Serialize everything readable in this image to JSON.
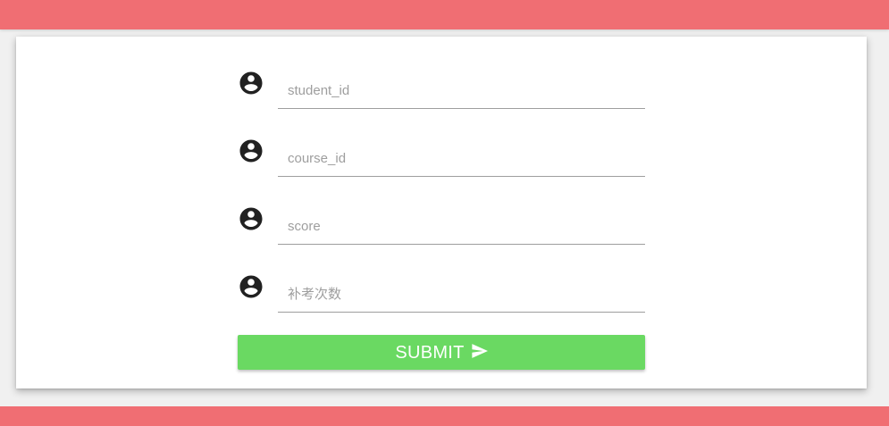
{
  "colors": {
    "bar": "#f06e73",
    "submit_bg": "#6ad962",
    "icon": "#212121"
  },
  "form": {
    "fields": [
      {
        "placeholder": "student_id",
        "value": "",
        "icon": "account-circle-icon"
      },
      {
        "placeholder": "course_id",
        "value": "",
        "icon": "account-circle-icon"
      },
      {
        "placeholder": "score",
        "value": "",
        "icon": "account-circle-icon"
      },
      {
        "placeholder": "补考次数",
        "value": "",
        "icon": "account-circle-icon"
      }
    ],
    "submit_label": "SUBMIT",
    "submit_icon": "send-icon"
  }
}
